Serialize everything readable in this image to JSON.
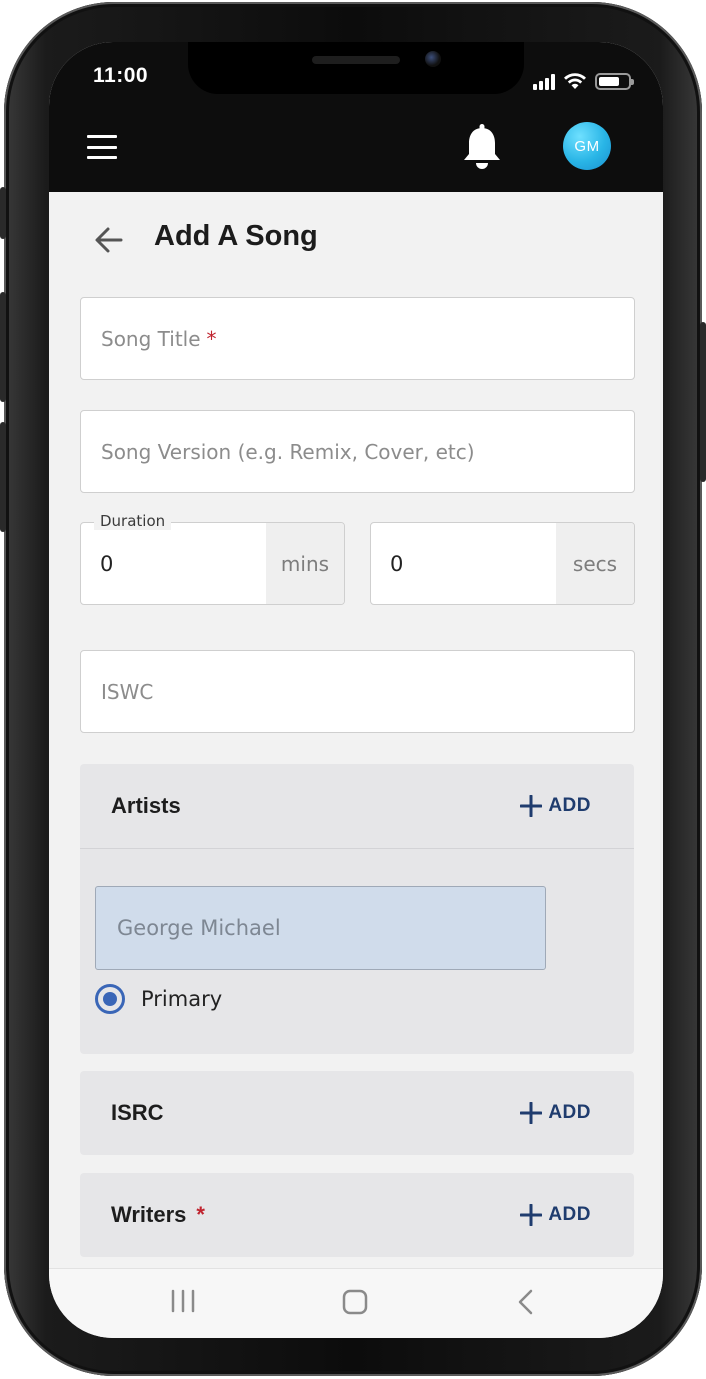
{
  "status_bar": {
    "time": "11:00",
    "battery_level": 0.7
  },
  "app_bar": {
    "menu_icon": "hamburger-menu-icon",
    "notification_icon": "bell-icon",
    "avatar_initials": "GM",
    "avatar_color": "#29b5e6"
  },
  "page": {
    "title": "Add A Song",
    "back_icon": "arrow-left-icon"
  },
  "form": {
    "song_title_placeholder": "Song Title",
    "song_title_required": "*",
    "song_version_placeholder": "Song Version (e.g. Remix, Cover, etc)",
    "duration": {
      "label": "Duration",
      "minutes_value": "0",
      "minutes_unit": "mins",
      "seconds_value": "0",
      "seconds_unit": "secs"
    },
    "iswc_placeholder": "ISWC"
  },
  "sections": {
    "artists": {
      "title": "Artists",
      "add_label": "ADD",
      "artist_name": "George Michael",
      "role_label": "Primary",
      "role_selected": true
    },
    "isrc": {
      "title": "ISRC",
      "add_label": "ADD"
    },
    "writers": {
      "title": "Writers",
      "required": "*",
      "add_label": "ADD"
    }
  },
  "navigation_bar": {
    "recents_icon": "recents-icon",
    "home_icon": "home-icon",
    "back_icon": "back-chevron-icon"
  },
  "colors": {
    "accent": "#1f3c6e",
    "required": "#c0242f",
    "radio": "#3a66b7",
    "chip_bg": "#d0dceb",
    "section_bg": "#e6e6e8"
  }
}
